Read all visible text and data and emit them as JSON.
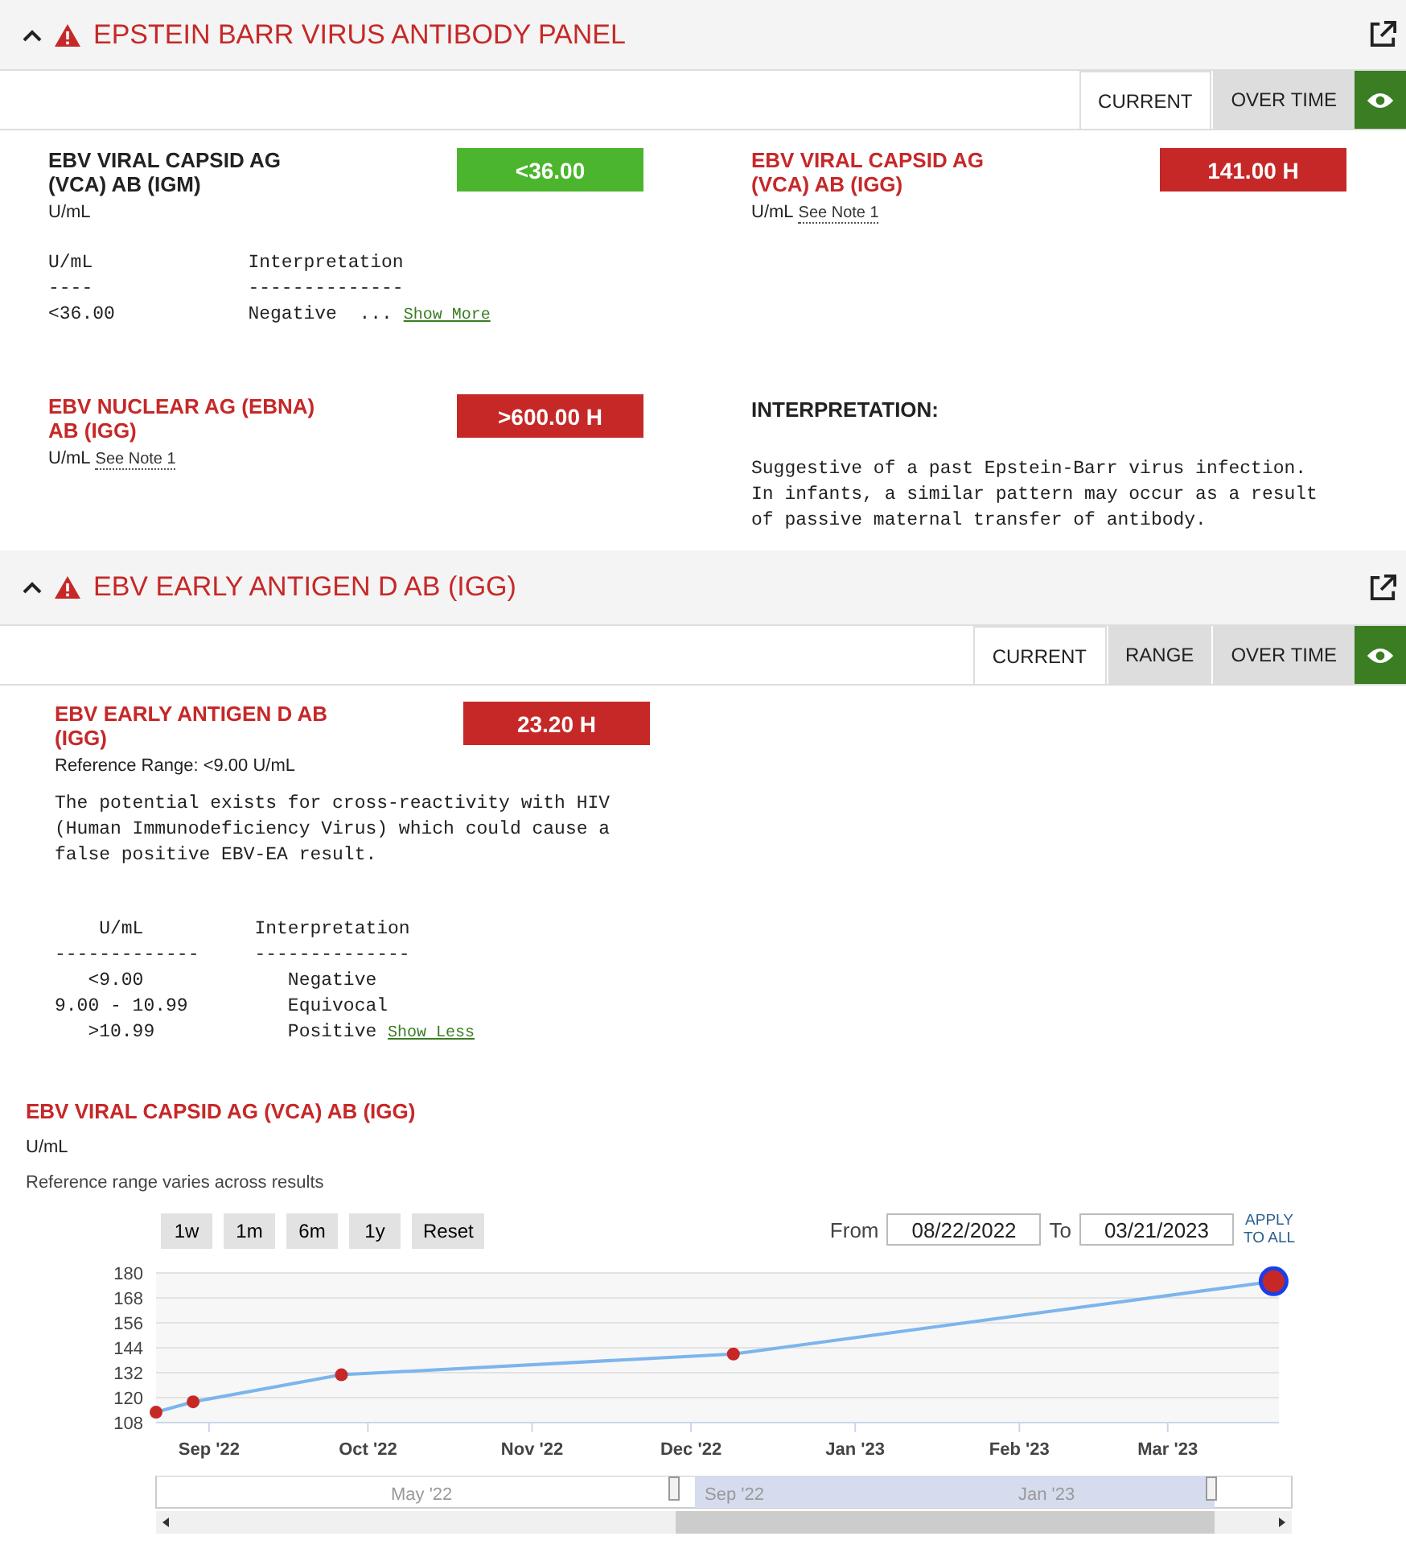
{
  "panels": [
    {
      "title": "EPSTEIN BARR VIRUS ANTIBODY PANEL",
      "expanded": true,
      "flagged": true,
      "tabs": [
        {
          "label": "CURRENT",
          "selected": true
        },
        {
          "label": "OVER TIME",
          "selected": false
        }
      ],
      "cells": [
        {
          "kind": "result",
          "name": "EBV VIRAL CAPSID AG (VCA) AB (IGM)",
          "abnormal": false,
          "value": "<36.00",
          "unit": "U/mL",
          "detail": "U/mL              Interpretation\n----              --------------\n<36.00            Negative  ...",
          "detail_link": "Show More"
        },
        {
          "kind": "result",
          "name": "EBV VIRAL CAPSID AG (VCA) AB (IGG)",
          "abnormal": true,
          "value": "141.00 H",
          "unit": "U/mL",
          "note_link": "See Note 1"
        },
        {
          "kind": "result",
          "name": "EBV NUCLEAR AG (EBNA) AB (IGG)",
          "abnormal": true,
          "value": ">600.00 H",
          "unit": "U/mL",
          "note_link": "See Note 1"
        },
        {
          "kind": "note",
          "heading": "INTERPRETATION:",
          "text": "Suggestive of a past Epstein-Barr virus infection.\nIn infants, a similar pattern may occur as a result\nof passive maternal transfer of antibody."
        }
      ]
    },
    {
      "title": "EBV EARLY ANTIGEN D AB (IGG)",
      "expanded": true,
      "flagged": true,
      "tabs": [
        {
          "label": "CURRENT",
          "selected": true
        },
        {
          "label": "RANGE",
          "selected": false
        },
        {
          "label": "OVER TIME",
          "selected": false
        }
      ],
      "cells": [
        {
          "kind": "result",
          "name": "EBV EARLY ANTIGEN D AB (IGG)",
          "abnormal": true,
          "value": "23.20 H",
          "reference_range": "Reference Range: <9.00 U/mL",
          "comment": "The potential exists for cross-reactivity with HIV\n(Human Immunodeficiency Virus) which could cause a\nfalse positive EBV-EA result.",
          "detail": "    U/mL          Interpretation\n-------------     --------------\n   <9.00             Negative\n9.00 - 10.99         Equivocal\n   >10.99            Positive",
          "detail_link": "Show Less"
        }
      ],
      "trend": {
        "title": "EBV VIRAL CAPSID AG (VCA) AB (IGG)",
        "unit": "U/mL",
        "note": "Reference range varies across results",
        "range_buttons": [
          "1w",
          "1m",
          "6m",
          "1y",
          "Reset"
        ],
        "from_label": "From",
        "from_value": "08/22/2022",
        "to_label": "To",
        "to_value": "03/21/2023",
        "apply_link": "APPLY TO ALL",
        "last_point_highlighted": true,
        "chart_data": {
          "type": "line",
          "x": [
            "2022-08-22",
            "2022-08-29",
            "2022-09-26",
            "2022-12-09",
            "2023-03-21"
          ],
          "series": [
            {
              "color": "#7cb5ec",
              "marker": true,
              "values": [
                113,
                118,
                131,
                141,
                176
              ]
            }
          ],
          "grid": true,
          "xlim": [
            "2022-08-22",
            "2023-03-22"
          ],
          "ylim": [
            108,
            180
          ],
          "xticks": [
            {
              "value": "2022-09-01",
              "label": "Sep '22"
            },
            {
              "value": "2022-10-01",
              "label": "Oct '22"
            },
            {
              "value": "2022-11-01",
              "label": "Nov '22"
            },
            {
              "value": "2022-12-01",
              "label": "Dec '22"
            },
            {
              "value": "2023-01-01",
              "label": "Jan '23"
            },
            {
              "value": "2023-02-01",
              "label": "Feb '23"
            },
            {
              "value": "2023-03-01",
              "label": "Mar '23"
            }
          ],
          "yticks": [
            108,
            120,
            132,
            144,
            156,
            168,
            180
          ]
        },
        "navigator_labels": [
          "May '22",
          "Sep '22",
          "Jan '23"
        ]
      }
    }
  ]
}
